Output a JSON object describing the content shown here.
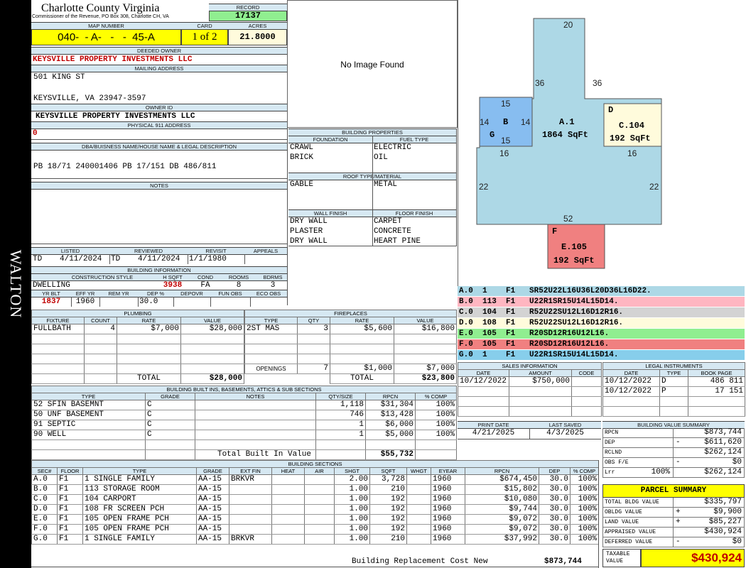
{
  "sidebar_name": "WALTON",
  "header": {
    "county": "Charlotte County Virginia",
    "office": "Commissioner of the Revenue, PO Box 308, Charlotte CH, VA",
    "record_label": "RECORD",
    "record": "17137",
    "map_label": "MAP NUMBER",
    "map_number": "040-  - A-   -   -  45-A",
    "card_label": "CARD",
    "card": "1 of 2",
    "acres_label": "ACRES",
    "acres": "21.8000"
  },
  "owner": {
    "deeded_label": "DEEDED OWNER",
    "deeded_owner": "KEYSVILLE PROPERTY INVESTMENTS LLC",
    "mailing_label": "MAILING ADDRESS",
    "mail_line1": "501 KING ST",
    "mail_line2": "KEYSVILLE, VA 23947-3597",
    "owner_id_label": "OWNER ID",
    "owner_id": "KEYSVILLE PROPERTY INVESTMENTS LLC",
    "physical_label": "PHYSICAL 911 ADDRESS",
    "physical": "0",
    "dba_label": "DBA/BUISNESS NAME/HOUSE NAME & LEGAL DESCRIPTION",
    "legal": "PB 18/71 240001406 PB 17/151 DB 486/811",
    "notes_label": "NOTES"
  },
  "photo": {
    "text": "No Image Found"
  },
  "building_props": {
    "title": "BUILDING PROPERTIES",
    "foundation_label": "FOUNDATION",
    "fuel_label": "FUEL TYPE",
    "foundation1": "CRAWL",
    "foundation2": "BRICK",
    "fuel1": "ELECTRIC",
    "fuel2": "OIL",
    "roof_label": "ROOF TYPE/MATERIAL",
    "roof_type": "GABLE",
    "roof_material": "METAL",
    "wall_label": "WALL FINISH",
    "floor_label": "FLOOR FINISH",
    "walls": [
      "DRY WALL",
      "PLASTER",
      "DRY WALL"
    ],
    "floors": [
      "CARPET",
      "CONCRETE",
      "HEART PINE"
    ]
  },
  "dates": {
    "listed_label": "LISTED",
    "reviewed_label": "REVIEWED",
    "revisit_label": "REVISIT",
    "appeals_label": "APPEALS",
    "listed_by": "TD",
    "listed": "4/11/2024",
    "reviewed_by": "TD",
    "reviewed": "4/11/2024",
    "revisit": "1/1/1980",
    "appeals": ""
  },
  "building_info": {
    "title": "BUILDING INFORMATION",
    "style_label": "CONSTRUCTION STYLE",
    "hsqft_label": "H SQFT",
    "cond_label": "COND",
    "rooms_label": "ROOMS",
    "bdrms_label": "BDRMS",
    "style": "DWELLING",
    "hsqft": "3938",
    "cond": "FA",
    "rooms": "8",
    "bdrms": "3",
    "yrblt_label": "YR BLT",
    "effyr_label": "EFF YR",
    "remyr_label": "REM YR",
    "dep_label": "DEP %",
    "depovr_label": "DEPOVR",
    "funobs_label": "FUN OBS",
    "ecoobs_label": "ECO OBS",
    "yrblt": "1837",
    "effyr": "1960",
    "remyr": "",
    "dep": "30.0",
    "depovr": "",
    "funobs": "",
    "ecoobs": ""
  },
  "plumbing": {
    "title": "PLUMBING",
    "headers": [
      "FIXTURE",
      "COUNT",
      "RATE",
      "VALUE"
    ],
    "rows": [
      [
        "FULLBATH",
        "4",
        "$7,000",
        "$28,000"
      ],
      [
        "",
        "",
        "",
        ""
      ],
      [
        "",
        "",
        "",
        ""
      ],
      [
        "",
        "",
        "",
        ""
      ],
      [
        "",
        "",
        "",
        ""
      ]
    ],
    "total_label": "TOTAL",
    "total": "$28,000"
  },
  "fireplaces": {
    "title": "FIREPLACES",
    "headers": [
      "TYPE",
      "QTY",
      "RATE",
      "VALUE"
    ],
    "rows": [
      [
        "2ST MAS",
        "3",
        "$5,600",
        "$16,800"
      ],
      [
        "",
        "",
        "",
        ""
      ],
      [
        "",
        "",
        "",
        ""
      ],
      [
        "",
        "",
        "",
        ""
      ],
      [
        "",
        "",
        "",
        ""
      ]
    ],
    "openings_label": "OPENINGS",
    "openings_qty": "7",
    "openings_rate": "$1,000",
    "openings_value": "$7,000",
    "total_label": "TOTAL",
    "total": "$23,800"
  },
  "builtins": {
    "title": "BUILDING BUILT INS, BASEMENTS, ATTICS & SUB SECTIONS",
    "headers": [
      "TYPE",
      "GRADE",
      "NOTES",
      "QTY/SIZE",
      "RPCN",
      "% COMP"
    ],
    "rows": [
      [
        "52 SFIN BASEMNT",
        "C",
        "",
        "1,118",
        "$31,304",
        "100%"
      ],
      [
        "50 UNF BASEMENT",
        "C",
        "",
        "746",
        "$13,428",
        "100%"
      ],
      [
        "91 SEPTIC",
        "C",
        "",
        "1",
        "$6,000",
        "100%"
      ],
      [
        "90 WELL",
        "C",
        "",
        "1",
        "$5,000",
        "100%"
      ],
      [
        "",
        "",
        "",
        "",
        "",
        ""
      ]
    ],
    "total_label": "Total Built In Value",
    "total": "$55,732"
  },
  "sections": {
    "title": "BUILDING SECTIONS",
    "headers": [
      "SEC#",
      "FLOOR",
      "TYPE",
      "GRADE",
      "EXT FIN",
      "HEAT",
      "AIR",
      "SHGT",
      "SQFT",
      "WHGT",
      "EYEAR",
      "RPCN",
      "DEP",
      "% COMP"
    ],
    "rows": [
      [
        "A.0",
        "F1",
        "1 SINGLE FAMILY",
        "AA-15",
        "BRKVR",
        "",
        "",
        "2.00",
        "3,728",
        "",
        "1960",
        "$674,450",
        "30.0",
        "100%"
      ],
      [
        "B.0",
        "F1",
        "113 STORAGE ROOM",
        "AA-15",
        "",
        "",
        "",
        "1.00",
        "210",
        "",
        "1960",
        "$15,802",
        "30.0",
        "100%"
      ],
      [
        "C.0",
        "F1",
        "104 CARPORT",
        "AA-15",
        "",
        "",
        "",
        "1.00",
        "192",
        "",
        "1960",
        "$10,080",
        "30.0",
        "100%"
      ],
      [
        "D.0",
        "F1",
        "108 FR SCREEN PCH",
        "AA-15",
        "",
        "",
        "",
        "1.00",
        "192",
        "",
        "1960",
        "$9,744",
        "30.0",
        "100%"
      ],
      [
        "E.0",
        "F1",
        "105 OPEN FRAME PCH",
        "AA-15",
        "",
        "",
        "",
        "1.00",
        "192",
        "",
        "1960",
        "$9,072",
        "30.0",
        "100%"
      ],
      [
        "F.0",
        "F1",
        "105 OPEN FRAME PCH",
        "AA-15",
        "",
        "",
        "",
        "1.00",
        "192",
        "",
        "1960",
        "$9,072",
        "30.0",
        "100%"
      ],
      [
        "G.0",
        "F1",
        "1 SINGLE FAMILY",
        "AA-15",
        "BRKVR",
        "",
        "",
        "1.00",
        "210",
        "",
        "1960",
        "$37,992",
        "30.0",
        "100%"
      ]
    ],
    "replacement_label": "Building Replacement Cost New",
    "replacement": "$873,744"
  },
  "sketch": {
    "areas": [
      {
        "key": "A",
        "label": "A.1",
        "sqft": "1864 SqFt",
        "color": "#add8e6"
      },
      {
        "key": "B",
        "label": "B",
        "letter": "G",
        "color": "#87bdf0"
      },
      {
        "key": "C",
        "label": "C.104",
        "sqft": "192 SqFt",
        "letter": "D",
        "color": "#fffbdc"
      },
      {
        "key": "E",
        "label": "E.105",
        "sqft": "192 SqFt",
        "letter": "F",
        "color": "#f08080"
      }
    ],
    "dims": {
      "top": "20",
      "left36": "36",
      "right36": "36",
      "b15top": "15",
      "b15bot": "15",
      "b14l": "14",
      "b14r": "14",
      "l16": "16",
      "r16": "16",
      "l22": "22",
      "r22": "22",
      "bot52": "52"
    },
    "legend": [
      {
        "text": "A.0  1    F1   SR52U22L16U36L20D36L16D22.",
        "color": "#add8e6"
      },
      {
        "text": "B.0  113  F1   U22R1SR15U14L15D14.",
        "color": "#ffb6c1"
      },
      {
        "text": "C.0  104  F1   R52U22SU12L16D12R16.",
        "color": "#d3d3d3"
      },
      {
        "text": "D.0  108  F1   R52U22SU12L16D12R16.",
        "color": "#fffbdc"
      },
      {
        "text": "E.0  105  F1   R20SD12R16U12L16.",
        "color": "#90ee90"
      },
      {
        "text": "F.0  105  F1   R20SD12R16U12L16.",
        "color": "#f08080"
      },
      {
        "text": "G.0  1    F1   U22R1SR15U14L15D14.",
        "color": "#87ceeb"
      }
    ]
  },
  "sales": {
    "title": "SALES INFORMATION",
    "headers": [
      "DATE",
      "AMOUNT",
      "CODE"
    ],
    "rows": [
      [
        "10/12/2022",
        "$750,000",
        ""
      ],
      [
        "",
        "",
        ""
      ],
      [
        "",
        "",
        ""
      ],
      [
        "",
        "",
        ""
      ]
    ]
  },
  "legal": {
    "title": "LEGAL INSTRUMENTS",
    "headers": [
      "DATE",
      "TYPE",
      "BOOK PAGE"
    ],
    "rows": [
      [
        "10/12/2022",
        "D",
        "486 811"
      ],
      [
        "10/12/2022",
        "P",
        "17 151"
      ],
      [
        "",
        "",
        ""
      ],
      [
        "",
        "",
        ""
      ]
    ]
  },
  "print": {
    "print_label": "PRINT DATE",
    "saved_label": "LAST SAVED",
    "print_date": "4/21/2025",
    "last_saved": "4/3/2025"
  },
  "bvs": {
    "title": "BUILDING VALUE SUMMARY",
    "rows": [
      {
        "label": "RPCN",
        "sign": "",
        "value": "$873,744"
      },
      {
        "label": "DEP",
        "sign": "-",
        "value": "$611,620"
      },
      {
        "label": "RCLND",
        "sign": "",
        "value": "$262,124"
      },
      {
        "label": "OBS F/E",
        "sign": "-",
        "value": "$0"
      },
      {
        "label": "Lrr",
        "pct": "100%",
        "sign": "",
        "value": "$262,124"
      }
    ]
  },
  "parcel": {
    "title": "PARCEL SUMMARY",
    "rows": [
      {
        "label": "TOTAL BLDG VALUE",
        "sign": "",
        "value": "$335,797"
      },
      {
        "label": "OBLDG VALUE",
        "sign": "+",
        "value": "$9,900"
      },
      {
        "label": "LAND VALUE",
        "sign": "+",
        "value": "$85,227"
      },
      {
        "label": "APPRAISED VALUE",
        "sign": "",
        "value": "$430,924"
      },
      {
        "label": "DEFERRED VALUE",
        "sign": "-",
        "value": "$0"
      }
    ],
    "taxable_label": "TAXABLE VALUE",
    "taxable": "$430,924"
  }
}
